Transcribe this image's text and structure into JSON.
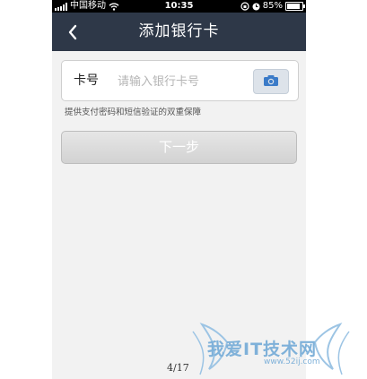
{
  "status_bar": {
    "carrier": "中国移动",
    "time": "10:35",
    "battery_percent": "85%",
    "battery_level": 0.85
  },
  "nav": {
    "title": "添加银行卡",
    "back_icon": "chevron-left-icon"
  },
  "form": {
    "card_label": "卡号",
    "card_placeholder": "请输入银行卡号",
    "card_value": "",
    "camera_icon": "camera-icon",
    "hint": "提供支付密码和短信验证的双重保障",
    "next_label": "下一步"
  },
  "page_indicator": "4/17",
  "watermark": {
    "text": "我爱IT技术网",
    "url": "www.52ij.com"
  },
  "colors": {
    "navbar": "#2e3848",
    "background": "#f2f2f2",
    "camera_button": "#dde3ea",
    "camera_icon": "#3b7bc8",
    "watermark": "#7fb1d9"
  }
}
